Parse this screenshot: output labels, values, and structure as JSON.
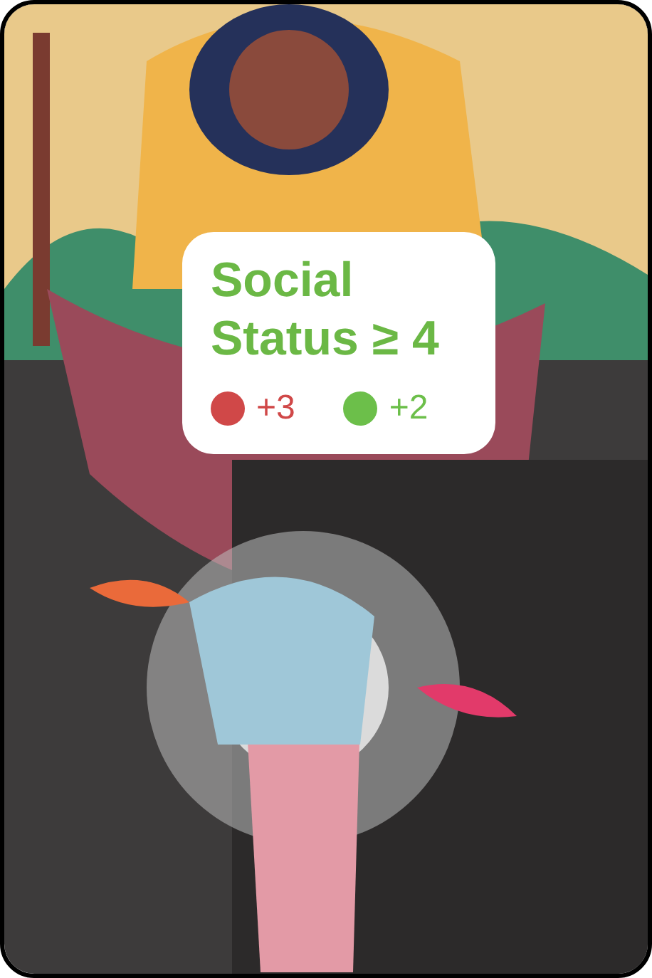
{
  "card": {
    "requirement": "Social Status ≥ 4",
    "effects": [
      {
        "value": "+3",
        "color": "#d04848"
      },
      {
        "value": "+2",
        "color": "#6cbf4a"
      }
    ]
  }
}
